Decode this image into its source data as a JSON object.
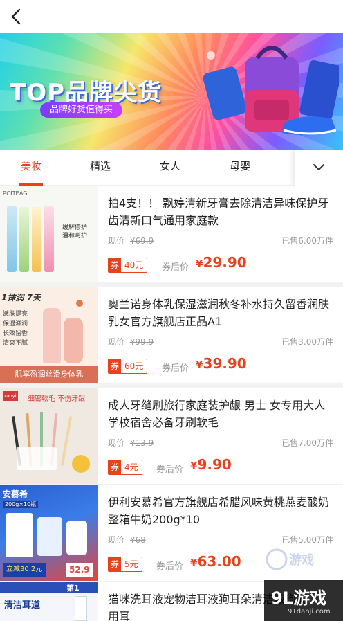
{
  "banner": {
    "title": "TOP品牌尖货",
    "subtitle": "品牌好货值得买"
  },
  "tabs": [
    "美妆",
    "精选",
    "女人",
    "母婴"
  ],
  "products": [
    {
      "title": "拍4支！！ 飘婷清新牙膏去除清洁异味保护牙齿清新口气通用家庭款",
      "orig_label": "现价",
      "orig_price": "¥69.9",
      "sold": "已售6.00万件",
      "coupon_tag": "券",
      "coupon_value": "40元",
      "after_label": "券后价",
      "after_price": "29.90",
      "thumb_brand": "POITEAG",
      "thumb_text1": "缓解修护",
      "thumb_text2": "温和呵护"
    },
    {
      "title": "奥兰诺身体乳保湿滋润秋冬补水持久留香润肤乳女官方旗舰店正品A1",
      "orig_label": "现价",
      "orig_price": "¥99.9",
      "sold": "已售3.00万件",
      "coupon_tag": "券",
      "coupon_value": "60元",
      "after_label": "券后价",
      "after_price": "39.90",
      "thumb_head": "1抹润 7天",
      "thumb_feats": [
        "嫩肤提亮",
        "保湿滋润",
        "长效留香",
        "清爽不腻"
      ],
      "thumb_foot": "肌享盈润丝滑身体乳"
    },
    {
      "title": "成人牙缝刷旅行家庭装护龈 男士 女专用大人学校宿舍必备牙刷软毛",
      "orig_label": "现价",
      "orig_price": "¥13.9",
      "sold": "已售7.00万件",
      "coupon_tag": "券",
      "coupon_value": "4元",
      "after_label": "券后价",
      "after_price": "9.90",
      "thumb_brand": "raoyi",
      "thumb_head": "细密软毛 不伤牙龈"
    },
    {
      "title": "伊利安慕希官方旗舰店希腊风味黄桃燕麦酸奶整箱牛奶200g*10",
      "orig_label": "现价",
      "orig_price": "¥68",
      "sold": "已售5.00万件",
      "coupon_tag": "券",
      "coupon_value": "5元",
      "after_label": "券后价",
      "after_price": "63.00",
      "thumb_brand": "安慕希",
      "thumb_head": "200g×10瓶",
      "thumb_foot": "立减30.2元",
      "thumb_price": "52.9"
    },
    {
      "title": "猫咪洗耳液宠物洁耳液狗耳朵清洁液狗猫用耳",
      "thumb_head": "清洁耳道",
      "thumb_sub": "第1"
    }
  ],
  "watermark": {
    "logo": "9L游戏",
    "url": "91danji.com"
  },
  "colors": {
    "accent": "#e8421c"
  }
}
